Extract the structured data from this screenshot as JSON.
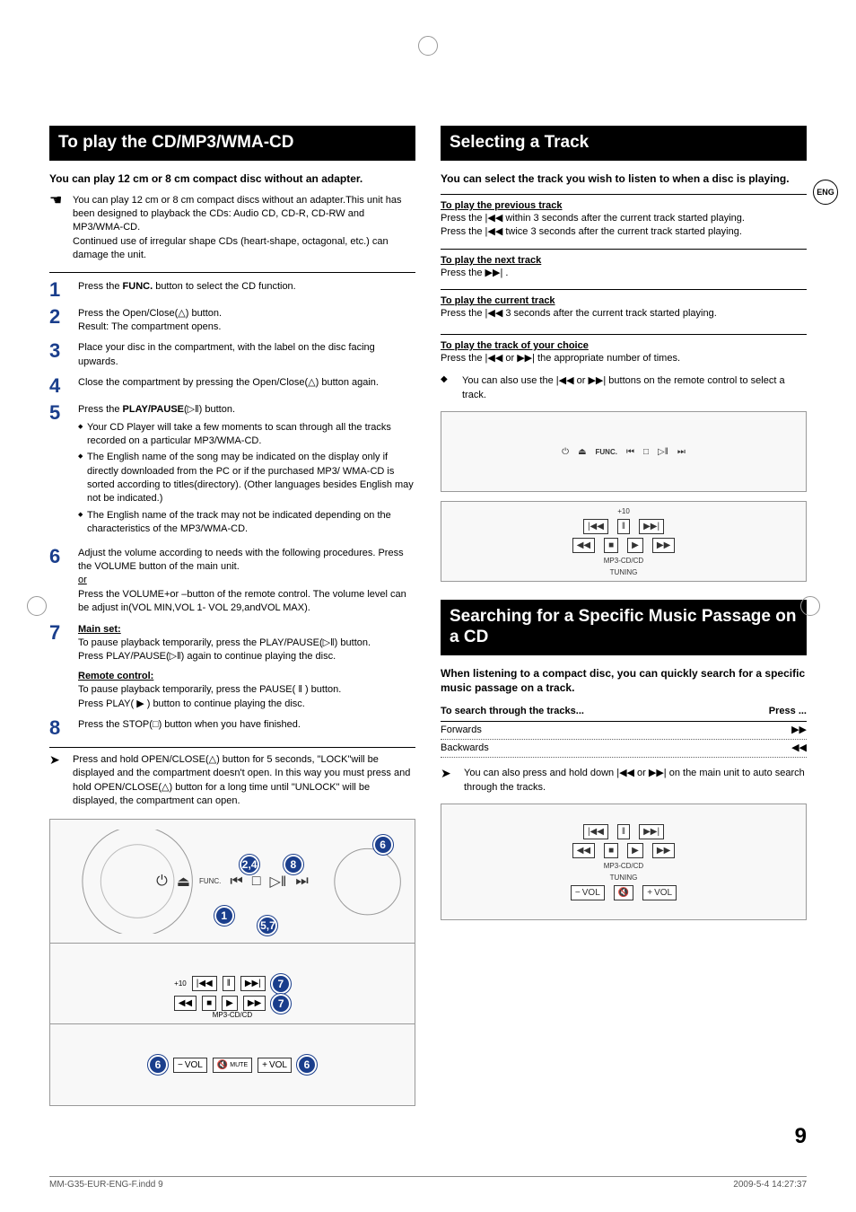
{
  "lang_badge": "ENG",
  "left": {
    "heading": "To play the CD/MP3/WMA-CD",
    "intro": "You can play 12 cm or 8 cm compact disc without an adapter.",
    "hand_note": "You can play 12 cm or 8 cm compact discs without an adapter.This unit has been designed to playback the CDs: Audio CD, CD-R, CD-RW and MP3/WMA-CD.\nContinued use of irregular shape CDs (heart-shape, octagonal, etc.) can damage the unit.",
    "steps": [
      {
        "n": "1",
        "pre": "Press the ",
        "bold": "FUNC.",
        "post": " button to select the CD function."
      },
      {
        "n": "2",
        "text": "Press the Open/Close(△) button.\nResult: The compartment opens."
      },
      {
        "n": "3",
        "text": "Place your disc in the compartment, with the label on the disc facing upwards."
      },
      {
        "n": "4",
        "text": "Close the compartment by pressing the Open/Close(△) button again."
      },
      {
        "n": "5",
        "pre": "Press the ",
        "bold": "PLAY/PAUSE",
        "post": "(▷‖) button.",
        "bullets": [
          "Your CD Player will take a few moments to scan through all the tracks recorded on a particular MP3/WMA-CD.",
          "The English name of the song may be indicated on the display only if directly downloaded from the PC or if the purchased MP3/ WMA-CD is sorted according to titles(directory). (Other languages besides English may not be indicated.)",
          "The English name of the track may not be indicated depending on the characteristics of the MP3/WMA-CD."
        ]
      },
      {
        "n": "6",
        "text": "Adjust the volume according to needs with the following procedures. Press the VOLUME button of the main unit.",
        "or": "or",
        "cont": "Press the VOLUME+or –button of the remote control. The volume level can be adjust in(VOL MIN,VOL 1- VOL 29,andVOL MAX)."
      },
      {
        "n": "7",
        "main_label": "Main set:",
        "main_text": "To pause playback temporarily, press the PLAY/PAUSE(▷‖) button.\nPress PLAY/PAUSE(▷‖) again to continue playing the disc.",
        "rc_label": "Remote control:",
        "rc_text": "To pause playback temporarily, press the PAUSE( ‖ ) button.\nPress PLAY( ▶ ) button to continue playing the disc."
      },
      {
        "n": "8",
        "text": "Press the STOP(□) button when you have finished."
      }
    ],
    "lock_note": "Press and hold OPEN/CLOSE(△) button for 5 seconds, \"LOCK\"will be displayed and the compartment doesn't open. In this way you must press and hold OPEN/CLOSE(△) button for a long time until \"UNLOCK\" will be displayed, the compartment can open.",
    "illus": {
      "badges_top": [
        "2,4",
        "8",
        "1",
        "5,7"
      ],
      "badges_mid": [
        "7",
        "7"
      ],
      "badges_bot": [
        "6",
        "6"
      ],
      "label_mp3": "MP3-CD/CD",
      "label_mute": "MUTE",
      "label_vol": "VOL"
    }
  },
  "right": {
    "heading": "Selecting a Track",
    "intro": "You can select the track you wish to listen to when a disc is playing.",
    "sections": [
      {
        "title": "To play the previous track",
        "lines": [
          "Press the  |◀◀  within 3 seconds after the current track started playing.",
          "Press the  |◀◀  twice 3 seconds after the current track started playing."
        ]
      },
      {
        "title": "To play the next track",
        "lines": [
          "Press the  ▶▶| ."
        ]
      },
      {
        "title": "To play the current track",
        "lines": [
          "Press the  |◀◀  3 seconds after the current track started playing."
        ]
      },
      {
        "title": "To play the track of your choice",
        "lines": [
          "Press the  |◀◀  or  ▶▶|   the appropriate number of times."
        ]
      }
    ],
    "remote_note": "You can also use the  |◀◀  or  ▶▶|  buttons on the remote control to select a track.",
    "panel_label": "FUNC.",
    "remote_plus10": "+10",
    "remote_mp3": "MP3-CD/CD",
    "remote_tuning": "TUNING"
  },
  "right2": {
    "heading": "Searching for a Specific Music Passage on a CD",
    "intro": "When listening to a compact disc, you can quickly search for a specific music passage on a track.",
    "table": {
      "h1": "To search through the tracks...",
      "h2": "Press ...",
      "rows": [
        {
          "a": "Forwards",
          "b": "▶▶"
        },
        {
          "a": "Backwards",
          "b": "◀◀"
        }
      ]
    },
    "note": "You can also press and hold down  |◀◀  or  ▶▶|  on the main unit to auto  search through the tracks.",
    "remote": {
      "mp3": "MP3-CD/CD",
      "tuning": "TUNING",
      "vol": "VOL"
    }
  },
  "page_number": "9",
  "footer_left": "MM-G35-EUR-ENG-F.indd   9",
  "footer_right": "2009-5-4   14:27:37"
}
